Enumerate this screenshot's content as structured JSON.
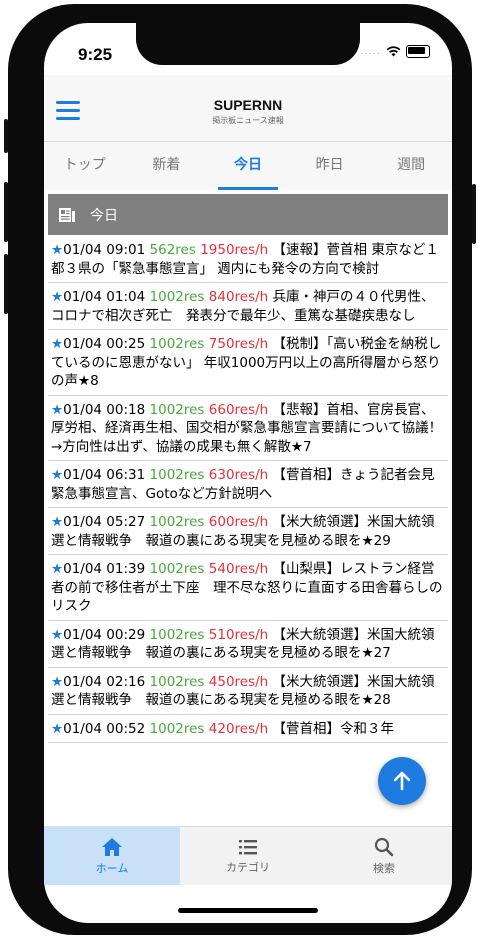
{
  "status_bar": {
    "time": "9:25",
    "signal": "....."
  },
  "header": {
    "title": "SUPERNN",
    "subtitle": "掲示板ニュース速報"
  },
  "tabs": [
    {
      "label": "トップ",
      "active": false
    },
    {
      "label": "新着",
      "active": false
    },
    {
      "label": "今日",
      "active": true
    },
    {
      "label": "昨日",
      "active": false
    },
    {
      "label": "週間",
      "active": false
    }
  ],
  "section": {
    "title": "今日",
    "icon": "newspaper-icon"
  },
  "articles": [
    {
      "star": "★",
      "datetime": "01/04 09:01",
      "res": "562res",
      "rate": "1950res/h",
      "title": "【速報】菅首相 東京など１都３県の「緊急事態宣言」 週内にも発令の方向で検討"
    },
    {
      "star": "★",
      "datetime": "01/04 01:04",
      "res": "1002res",
      "rate": "840res/h",
      "title": "兵庫・神戸の４０代男性、コロナで相次ぎ死亡　発表分で最年少、重篤な基礎疾患なし"
    },
    {
      "star": "★",
      "datetime": "01/04 00:25",
      "res": "1002res",
      "rate": "750res/h",
      "title": "【税制】「高い税金を納税しているのに恩恵がない」 年収1000万円以上の高所得層から怒りの声★8"
    },
    {
      "star": "★",
      "datetime": "01/04 00:18",
      "res": "1002res",
      "rate": "660res/h",
      "title": "【悲報】首相、官房長官、厚労相、経済再生相、国交相が緊急事態宣言要請について協議！→方向性は出ず、協議の成果も無く解散★7"
    },
    {
      "star": "★",
      "datetime": "01/04 06:31",
      "res": "1002res",
      "rate": "630res/h",
      "title": "【菅首相】きょう記者会見　緊急事態宣言、Gotoなど方針説明へ"
    },
    {
      "star": "★",
      "datetime": "01/04 05:27",
      "res": "1002res",
      "rate": "600res/h",
      "title": "【米大統領選】米国大統領選と情報戦争　報道の裏にある現実を見極める眼を★29"
    },
    {
      "star": "★",
      "datetime": "01/04 01:39",
      "res": "1002res",
      "rate": "540res/h",
      "title": "【山梨県】レストラン経営者の前で移住者が土下座　理不尽な怒りに直面する田舎暮らしのリスク"
    },
    {
      "star": "★",
      "datetime": "01/04 00:29",
      "res": "1002res",
      "rate": "510res/h",
      "title": "【米大統領選】米国大統領選と情報戦争　報道の裏にある現実を見極める眼を★27"
    },
    {
      "star": "★",
      "datetime": "01/04 02:16",
      "res": "1002res",
      "rate": "450res/h",
      "title": "【米大統領選】米国大統領選と情報戦争　報道の裏にある現実を見極める眼を★28"
    },
    {
      "star": "★",
      "datetime": "01/04 00:52",
      "res": "1002res",
      "rate": "420res/h",
      "title": "【菅首相】令和３年"
    }
  ],
  "scroll_top_button": {
    "icon": "arrow-up-icon"
  },
  "bottom_nav": [
    {
      "label": "ホーム",
      "icon": "home-icon",
      "active": true
    },
    {
      "label": "カテゴリ",
      "icon": "list-icon",
      "active": false
    },
    {
      "label": "検索",
      "icon": "search-icon",
      "active": false
    }
  ],
  "colors": {
    "accent": "#1e7be0",
    "res": "#49a93c",
    "rate": "#e0323a",
    "section_bg": "#808080",
    "nav_active_bg": "#c8e0f8"
  }
}
